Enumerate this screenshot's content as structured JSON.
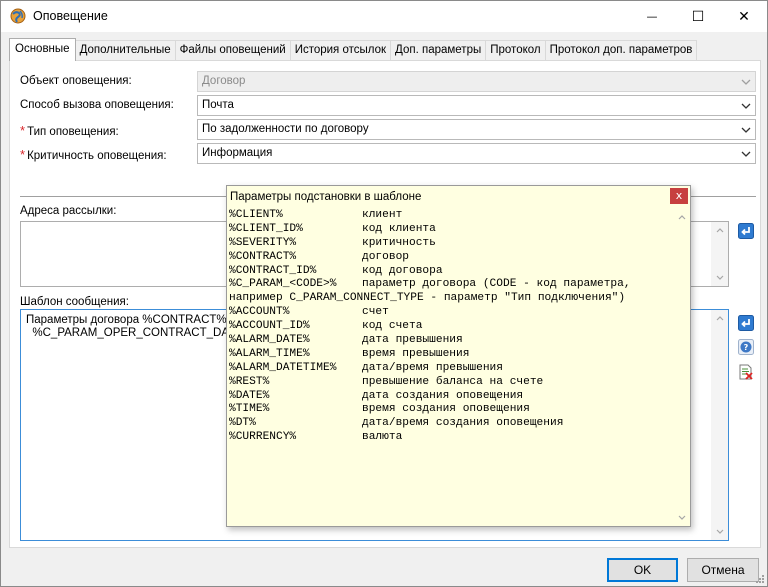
{
  "window": {
    "title": "Оповещение",
    "minimize_glyph": "—",
    "maximize_glyph": "☐",
    "close_glyph": "✕"
  },
  "tabs": [
    {
      "label": "Основные",
      "active": true
    },
    {
      "label": "Дополнительные",
      "active": false
    },
    {
      "label": "Файлы оповещений",
      "active": false
    },
    {
      "label": "История отсылок",
      "active": false
    },
    {
      "label": "Доп. параметры",
      "active": false
    },
    {
      "label": "Протокол",
      "active": false
    },
    {
      "label": "Протокол доп. параметров",
      "active": false
    }
  ],
  "form": {
    "fields": [
      {
        "label": "Объект оповещения:",
        "required": false,
        "value": "Договор",
        "disabled": true
      },
      {
        "label": "Способ вызова оповещения:",
        "required": false,
        "value": "Почта",
        "disabled": false
      },
      {
        "label": "Тип оповещения:",
        "required": true,
        "value": "По задолженности по договору",
        "disabled": false
      },
      {
        "label": "Критичность оповещения:",
        "required": true,
        "value": "Информация",
        "disabled": false
      }
    ],
    "required_mark": "*"
  },
  "addresses": {
    "label": "Адреса рассылки:",
    "value": ""
  },
  "template": {
    "label": "Шаблон сообщения:",
    "line1": "Параметры договора %CONTRACT%:",
    "line2": "  %C_PARAM_OPER_CONTRACT_DATE%..."
  },
  "popup": {
    "title": "Параметры подстановки в шаблоне",
    "close_glyph": "x",
    "rows": [
      {
        "key": "%CLIENT%",
        "desc": "клиент"
      },
      {
        "key": "%CLIENT_ID%",
        "desc": "код клиента"
      },
      {
        "key": "%SEVERITY%",
        "desc": "критичность"
      },
      {
        "key": "%CONTRACT%",
        "desc": "договор"
      },
      {
        "key": "%CONTRACT_ID%",
        "desc": "код договора"
      },
      {
        "key": "%C_PARAM_<CODE>%",
        "desc": "параметр договора (CODE - код параметра,"
      },
      {
        "key": "",
        "desc": "например C_PARAM_CONNECT_TYPE - параметр \"Тип подключения\")",
        "full": true
      },
      {
        "key": "%ACCOUNT%",
        "desc": "счет"
      },
      {
        "key": "%ACCOUNT_ID%",
        "desc": "код счета"
      },
      {
        "key": "%ALARM_DATE%",
        "desc": "дата превышения"
      },
      {
        "key": "%ALARM_TIME%",
        "desc": "время превышения"
      },
      {
        "key": "%ALARM_DATETIME%",
        "desc": "дата/время превышения"
      },
      {
        "key": "%REST%",
        "desc": "превышение баланса на счете"
      },
      {
        "key": "%DATE%",
        "desc": "дата создания оповещения"
      },
      {
        "key": "%TIME%",
        "desc": "время создания оповещения"
      },
      {
        "key": "%DT%",
        "desc": "дата/время создания оповещения"
      },
      {
        "key": "%CURRENCY%",
        "desc": "валюта"
      }
    ]
  },
  "footer": {
    "ok_label": "OK",
    "cancel_label": "Отмена"
  },
  "colors": {
    "accent": "#0078d7",
    "popup_bg": "#ffffe1",
    "required": "#d9262b",
    "close_red": "#c7403f"
  }
}
